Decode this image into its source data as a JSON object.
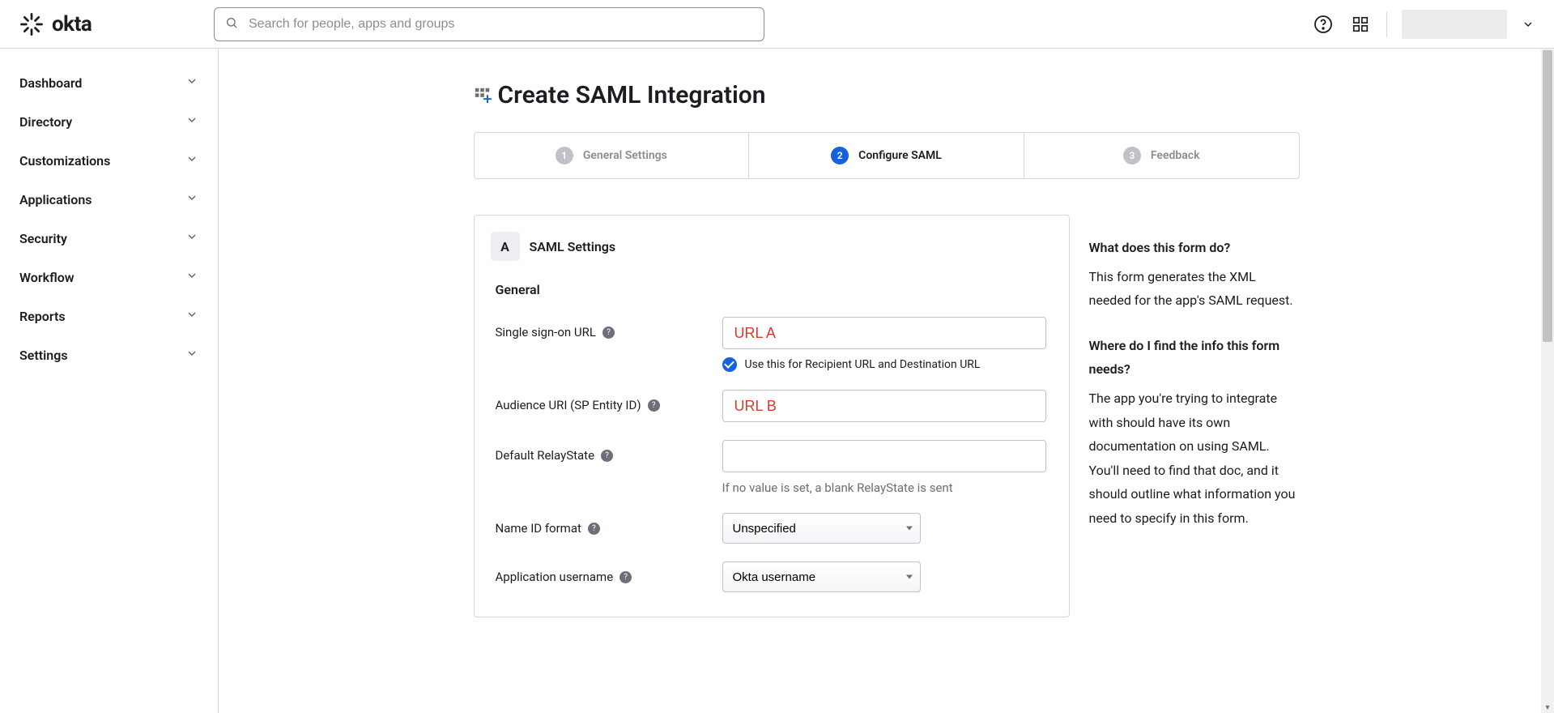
{
  "search": {
    "placeholder": "Search for people, apps and groups"
  },
  "logo": {
    "text": "okta"
  },
  "sidebar": {
    "items": [
      {
        "label": "Dashboard"
      },
      {
        "label": "Directory"
      },
      {
        "label": "Customizations"
      },
      {
        "label": "Applications"
      },
      {
        "label": "Security"
      },
      {
        "label": "Workflow"
      },
      {
        "label": "Reports"
      },
      {
        "label": "Settings"
      }
    ]
  },
  "page": {
    "title": "Create SAML Integration"
  },
  "steps": [
    {
      "num": "1",
      "label": "General Settings"
    },
    {
      "num": "2",
      "label": "Configure SAML"
    },
    {
      "num": "3",
      "label": "Feedback"
    }
  ],
  "section": {
    "badge": "A",
    "title": "SAML Settings",
    "subhead": "General",
    "fields": {
      "sso_url": {
        "label": "Single sign-on URL",
        "value": "URL A",
        "checkbox_label": "Use this for Recipient URL and Destination URL"
      },
      "audience": {
        "label": "Audience URI (SP Entity ID)",
        "value": "URL B"
      },
      "relay": {
        "label": "Default RelayState",
        "value": "",
        "helper": "If no value is set, a blank RelayState is sent"
      },
      "nameid": {
        "label": "Name ID format",
        "value": "Unspecified"
      },
      "appuser": {
        "label": "Application username",
        "value": "Okta username"
      }
    }
  },
  "help": {
    "q1_title": "What does this form do?",
    "q1_body": "This form generates the XML needed for the app's SAML request.",
    "q2_title": "Where do I find the info this form needs?",
    "q2_body": "The app you're trying to integrate with should have its own documentation on using SAML. You'll need to find that doc, and it should outline what information you need to specify in this form."
  }
}
